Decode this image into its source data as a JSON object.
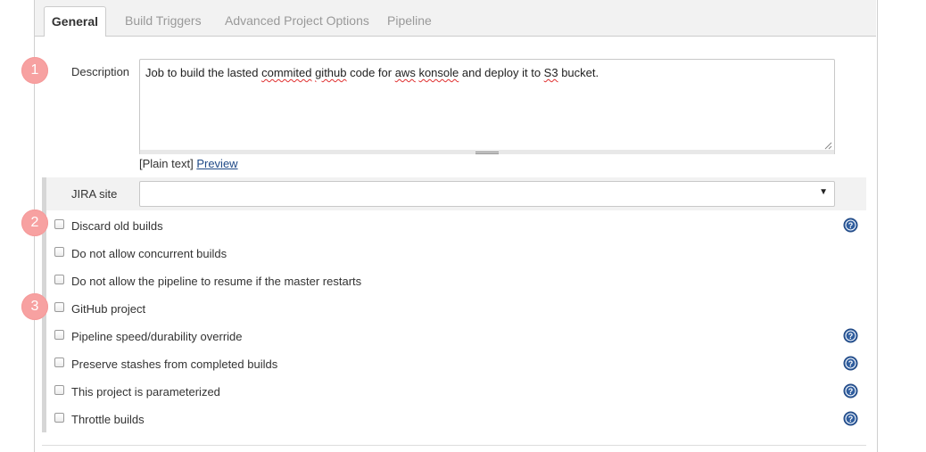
{
  "tabs": [
    {
      "label": "General",
      "active": true
    },
    {
      "label": "Build Triggers",
      "active": false
    },
    {
      "label": "Advanced Project Options",
      "active": false
    },
    {
      "label": "Pipeline",
      "active": false
    }
  ],
  "badges": [
    "1",
    "2",
    "3"
  ],
  "description": {
    "label": "Description",
    "value_parts": [
      "Job to build the lasted ",
      "commited",
      " ",
      "github",
      " code for ",
      "aws",
      " ",
      "konsole",
      " and deploy it to ",
      "S3",
      " bucket."
    ],
    "plain_text": "[Plain text]",
    "preview": "Preview"
  },
  "jira": {
    "label": "JIRA site",
    "value": ""
  },
  "options": [
    {
      "label": "Discard old builds",
      "checked": false,
      "help": true
    },
    {
      "label": "Do not allow concurrent builds",
      "checked": false,
      "help": false
    },
    {
      "label": "Do not allow the pipeline to resume if the master restarts",
      "checked": false,
      "help": false
    },
    {
      "label": "GitHub project",
      "checked": false,
      "help": false
    },
    {
      "label": "Pipeline speed/durability override",
      "checked": false,
      "help": true
    },
    {
      "label": "Preserve stashes from completed builds",
      "checked": false,
      "help": true
    },
    {
      "label": "This project is parameterized",
      "checked": false,
      "help": true
    },
    {
      "label": "Throttle builds",
      "checked": false,
      "help": true
    }
  ],
  "colors": {
    "badge": "#f7a1a1",
    "help_icon": "#2f5d9e",
    "link": "#204a87"
  }
}
